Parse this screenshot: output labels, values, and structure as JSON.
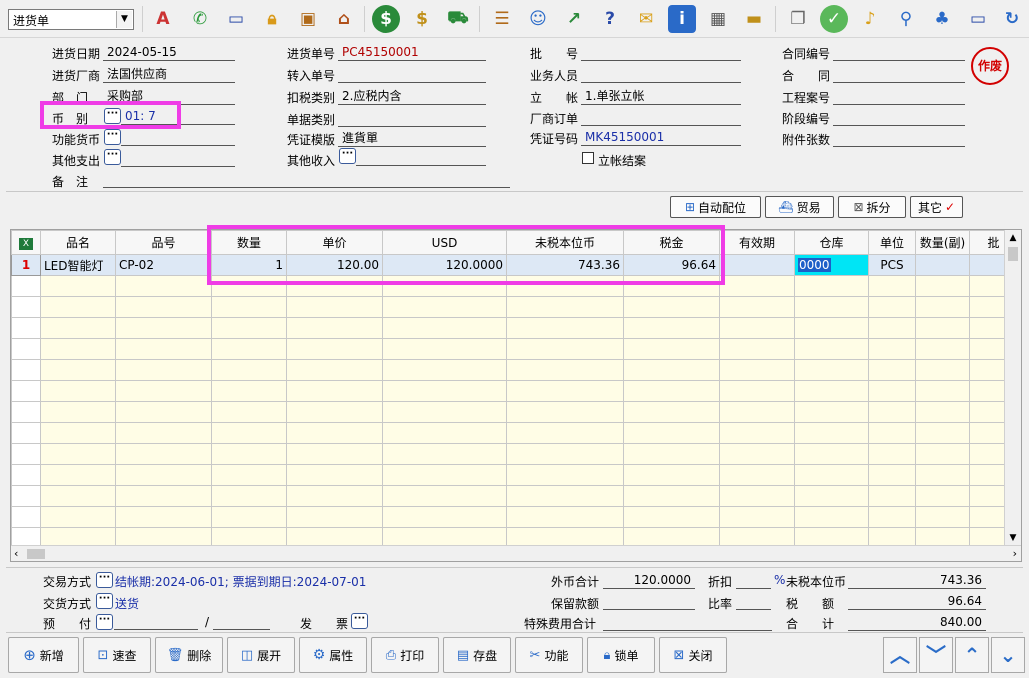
{
  "toolbar": {
    "doc_type": "进货单",
    "icons": [
      "spellcheck-icon",
      "phone-icon",
      "computer-icon",
      "lock-icon",
      "briefcase-icon",
      "home-icon",
      "dollar-icon",
      "money-bag-icon",
      "cart-icon",
      "clipboard-icon",
      "users-icon",
      "link-icon",
      "help-doc-icon",
      "mail-icon",
      "info-icon",
      "calculator-icon",
      "folder-icon",
      "documents-icon",
      "check-icon",
      "bell-icon",
      "search-icon",
      "org-chart-icon",
      "monitor-icon",
      "refresh-icon"
    ]
  },
  "header": {
    "date_label": "进货日期",
    "date_value": "2024-05-15",
    "vendor_label": "进货厂商",
    "vendor_value": "法国供应商",
    "dept_label": "部　门",
    "dept_value": "采购部",
    "currency_label": "币　别",
    "currency_value": "01: 7",
    "func_currency_label": "功能货币",
    "other_expense_label": "其他支出",
    "remark_label": "备　注",
    "order_no_label": "进货单号",
    "order_no_value": "PC45150001",
    "transfer_no_label": "转入单号",
    "tax_type_label": "扣税类别",
    "tax_type_value": "2.应税内含",
    "doc_type_label": "单据类别",
    "voucher_tpl_label": "凭证模版",
    "voucher_tpl_value": "進貨單",
    "other_income_label": "其他收入",
    "batch_label": "批　　号",
    "staff_label": "业务人员",
    "account_label": "立　　帐",
    "account_value": "1.单张立帐",
    "vendor_order_label": "厂商订单",
    "voucher_no_label": "凭证号码",
    "voucher_no_value": "MK45150001",
    "close_label": "立帐结案",
    "contract_no_label": "合同编号",
    "contract_label": "合　　同",
    "project_label": "工程案号",
    "stage_label": "阶段编号",
    "attach_label": "附件张数",
    "stamp_text": "作废"
  },
  "actions": {
    "auto_alloc": "自动配位",
    "trade": "贸易",
    "split": "拆分",
    "other": "其它"
  },
  "grid": {
    "headers": [
      "品名",
      "品号",
      "数量",
      "单价",
      "USD",
      "未税本位币",
      "税金",
      "有效期",
      "仓库",
      "单位",
      "数量(副)",
      "批"
    ],
    "rows": [
      {
        "no": "1",
        "name": "LED智能灯",
        "code": "CP-02",
        "qty": "1",
        "price": "120.00",
        "usd": "120.0000",
        "base": "743.36",
        "tax": "96.64",
        "expiry": "",
        "warehouse": "0000",
        "unit": "PCS",
        "qty2": "",
        "batch": ""
      }
    ]
  },
  "footer": {
    "trade_method_label": "交易方式",
    "trade_method_value": "结帐期:2024-06-01; 票据到期日:2024-07-01",
    "delivery_label": "交货方式",
    "delivery_value": "送货",
    "prepay_label": "预　　付",
    "slash": "/",
    "invoice_label": "发　　票",
    "fx_total_label": "外币合计",
    "fx_total_value": "120.0000",
    "discount_label": "折扣",
    "percent": "%",
    "base_untaxed_label": "未税本位币",
    "base_untaxed_value": "743.36",
    "retention_label": "保留款额",
    "rate_label": "比率",
    "tax_label": "税　　额",
    "tax_value": "96.64",
    "special_fee_label": "特殊费用合计",
    "total_label": "合　　计",
    "total_value": "840.00"
  },
  "buttons": {
    "new": "新增",
    "query": "速查",
    "delete": "删除",
    "expand": "展开",
    "props": "属性",
    "print": "打印",
    "save": "存盘",
    "func": "功能",
    "lock": "锁单",
    "close": "关闭"
  }
}
